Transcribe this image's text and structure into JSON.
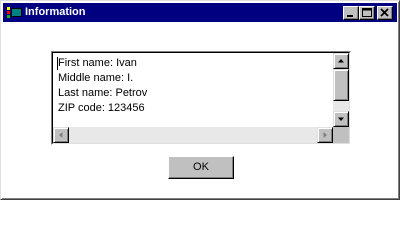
{
  "window": {
    "title": "Information",
    "title_bar_color": "#000080",
    "icon": "app-icon",
    "controls": [
      "minimize-icon",
      "maximize-icon",
      "close-icon"
    ]
  },
  "info_text": {
    "lines": [
      "First name: Ivan",
      "Middle name: I.",
      "Last name: Petrov",
      "ZIP code: 123456"
    ]
  },
  "scrollbars": {
    "vertical_icons": [
      "scroll-up-arrow-icon",
      "scroll-down-arrow-icon"
    ],
    "horizontal_icons": [
      "scroll-left-arrow-icon",
      "scroll-right-arrow-icon"
    ]
  },
  "buttons": {
    "ok_label": "OK"
  }
}
